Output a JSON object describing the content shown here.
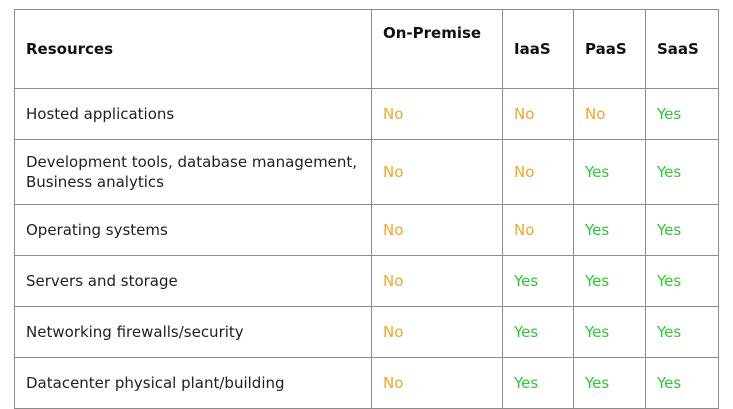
{
  "table": {
    "headers": {
      "resources": "Resources",
      "on_premise": "On-Premise",
      "iaas": "IaaS",
      "paas": "PaaS",
      "saas": "SaaS"
    },
    "rows": [
      {
        "resource": "Hosted applications",
        "on_premise": "No",
        "iaas": "No",
        "paas": "No",
        "saas": "Yes"
      },
      {
        "resource": "Development tools, database management,\nBusiness analytics",
        "on_premise": "No",
        "iaas": "No",
        "paas": "Yes",
        "saas": "Yes"
      },
      {
        "resource": "Operating systems",
        "on_premise": "No",
        "iaas": "No",
        "paas": "Yes",
        "saas": "Yes"
      },
      {
        "resource": "Servers and storage",
        "on_premise": "No",
        "iaas": "Yes",
        "paas": "Yes",
        "saas": "Yes"
      },
      {
        "resource": "Networking firewalls/security",
        "on_premise": "No",
        "iaas": "Yes",
        "paas": "Yes",
        "saas": "Yes"
      },
      {
        "resource": "Datacenter physical plant/building",
        "on_premise": "No",
        "iaas": "Yes",
        "paas": "Yes",
        "saas": "Yes"
      }
    ]
  },
  "colors": {
    "no": "#f5a623",
    "yes": "#2ec92e",
    "border": "#8c8c8c"
  }
}
